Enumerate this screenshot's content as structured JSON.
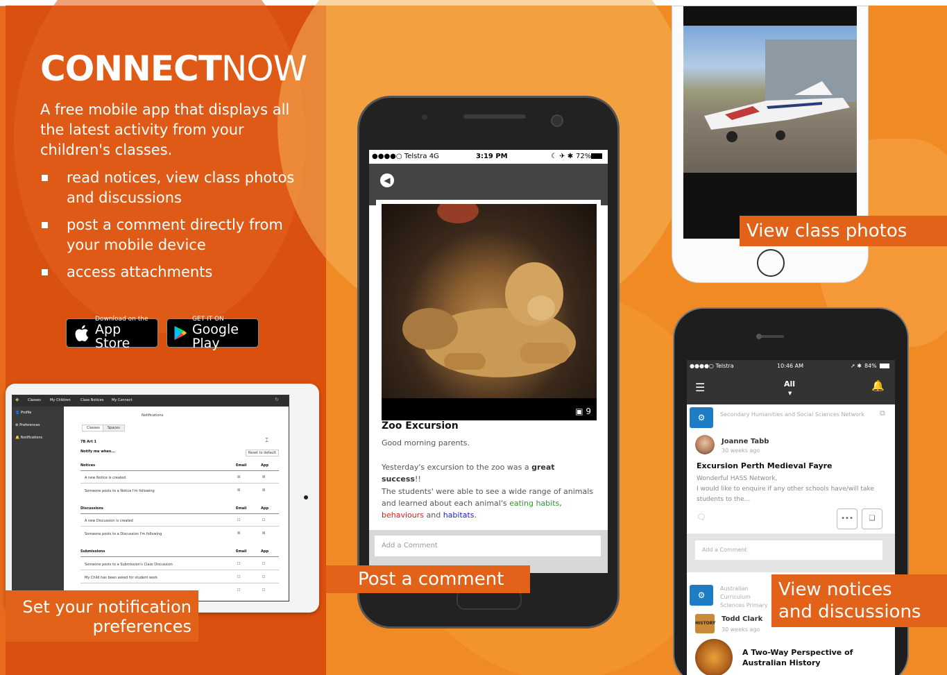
{
  "hero": {
    "title_bold": "CONNECT",
    "title_light": "NOW",
    "intro": "A free mobile app that displays all the latest activity from your children's classes.",
    "bullets": [
      "read notices, view class photos and discussions",
      "post a comment directly from your mobile device",
      "access attachments"
    ]
  },
  "stores": {
    "appstore_small": "Download on the",
    "appstore_big": "App Store",
    "gplay_small": "GET IT ON",
    "gplay_big": "Google Play"
  },
  "callouts": {
    "notification": "Set your notification\npreferences",
    "post": "Post a comment",
    "photos": "View class photos",
    "notices": "View notices\nand discussions"
  },
  "tablet": {
    "nav": [
      "Classes",
      "My Children",
      "Class Notices",
      "My Connect"
    ],
    "side": [
      "Profile",
      "Preferences",
      "Notifications"
    ],
    "heading": "Notifications",
    "tabs": [
      "Classes",
      "Spaces"
    ],
    "class_label": "7B Art 1",
    "notify_label": "Notify me when...",
    "reset": "Reset to default",
    "col_email": "Email",
    "col_app": "App",
    "sections": [
      {
        "name": "Notices",
        "rows": [
          "A new Notice is created",
          "Someone posts to a Notice I'm following"
        ]
      },
      {
        "name": "Discussions",
        "rows": [
          "A new Discussion is created",
          "Someone posts to a Discussion I'm following"
        ]
      },
      {
        "name": "Submissions",
        "rows": [
          "Someone posts to a Submission's Class Discussion",
          "My Child has been asked for student work",
          ""
        ]
      }
    ]
  },
  "center_phone": {
    "carrier": "●●●●○ Telstra  4G",
    "time": "3:19 PM",
    "battery": "72%",
    "photo_count": "9",
    "post_title": "Zoo Excursion",
    "greeting": "Good morning parents.",
    "line1_a": "Yesterday's excursion to the zoo was a ",
    "line1_b": "great success",
    "line1_c": "!!",
    "line2_a": "The students' were able to see a wide range of animals and learned about each animal's ",
    "line2_green": "eating habits",
    "line2_b": ", ",
    "line2_red": "behaviours",
    "line2_c": " and ",
    "line2_blue": "habitats",
    "line2_d": ".",
    "comment_placeholder": "Add a Comment"
  },
  "right_phone": {
    "carrier": "●●●●○ Telstra",
    "time": "10:46 AM",
    "battery": "84%",
    "header_label": "All",
    "post1": {
      "network": "Secondary Humanities and Social Sciences Network",
      "author": "Joanne Tabb",
      "time_ago": "30 weeks ago",
      "title": "Excursion Perth Medieval Fayre",
      "body": "Wonderful HASS Network,\nI would like to enquire if any other schools have/will take students to the..."
    },
    "comment_placeholder": "Add a Comment",
    "post2": {
      "network": "Australian Curriculum Sciences Primary",
      "author": "Todd Clark",
      "time_ago": "30 weeks ago",
      "avatar_text": "HISTORY",
      "title": "A Two-Way Perspective of Australian History"
    }
  },
  "colors": {
    "primary_orange": "#e86a1c",
    "dark_orange": "#d9500f",
    "network_blue": "#1e7cc4"
  }
}
